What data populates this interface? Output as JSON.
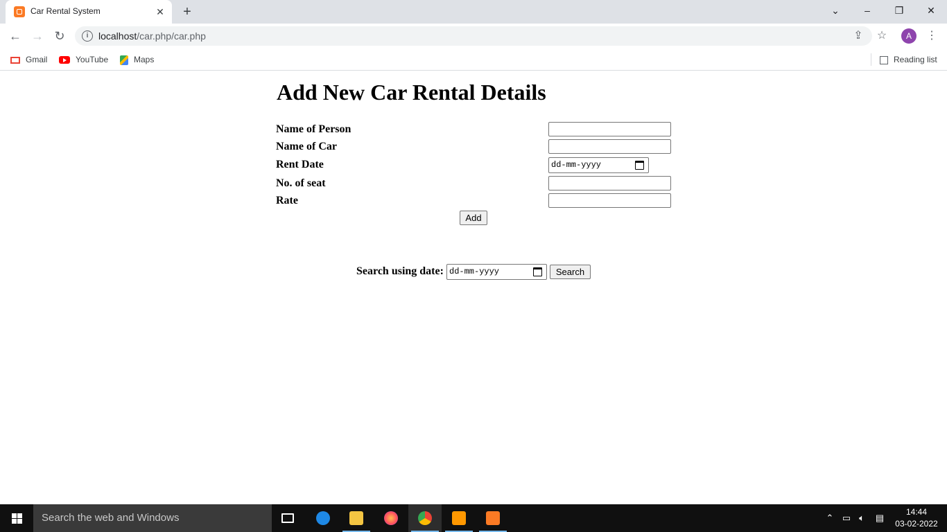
{
  "browser": {
    "tab_title": "Car Rental System",
    "url_host": "localhost",
    "url_path": "/car.php/car.php",
    "avatar_letter": "A",
    "bookmarks": [
      "Gmail",
      "YouTube",
      "Maps"
    ],
    "reading_list": "Reading list"
  },
  "page": {
    "heading": "Add New Car Rental Details",
    "fields": [
      {
        "label": "Name of Person",
        "value": ""
      },
      {
        "label": "Name of Car",
        "value": ""
      },
      {
        "label": "Rent Date",
        "placeholder": "dd-mm-yyyy"
      },
      {
        "label": "No. of seat",
        "value": ""
      },
      {
        "label": "Rate",
        "value": ""
      }
    ],
    "add_button": "Add",
    "search_label": "Search using date:",
    "search_date_placeholder": "dd-mm-yyyy",
    "search_button": "Search"
  },
  "taskbar": {
    "search_placeholder": "Search the web and Windows",
    "time": "14:44",
    "date": "03-02-2022"
  }
}
